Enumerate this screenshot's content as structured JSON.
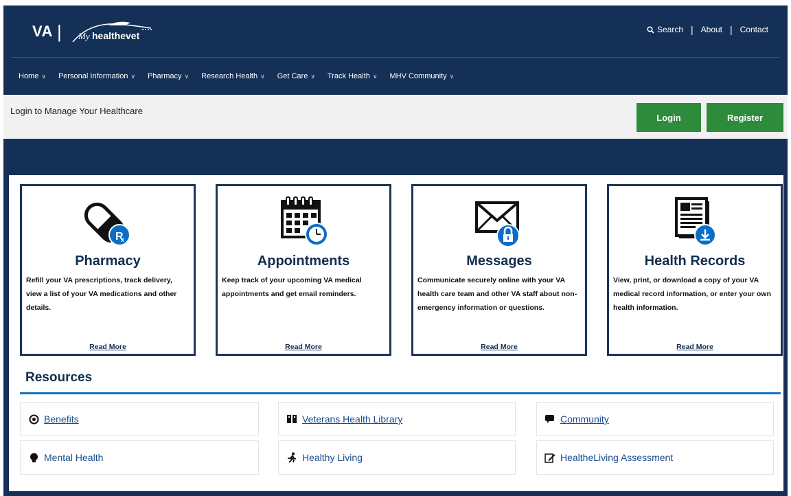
{
  "header": {
    "logo_va": "VA",
    "logo_mhv_script": "My",
    "logo_mhv_text": "healthevet",
    "links": {
      "search": "Search",
      "about": "About",
      "contact": "Contact"
    }
  },
  "nav": {
    "items": [
      {
        "label": "Home"
      },
      {
        "label": "Personal Information"
      },
      {
        "label": "Pharmacy"
      },
      {
        "label": "Research Health"
      },
      {
        "label": "Get Care"
      },
      {
        "label": "Track Health"
      },
      {
        "label": "MHV Community"
      }
    ]
  },
  "login_bar": {
    "text": "Login to Manage Your Healthcare",
    "login_label": "Login",
    "register_label": "Register"
  },
  "cards": [
    {
      "title": "Pharmacy",
      "icon": "pharmacy-rx-icon",
      "desc": "Refill your VA prescriptions, track delivery, view a list of your VA medications and other details.",
      "more": "Read More"
    },
    {
      "title": "Appointments",
      "icon": "calendar-clock-icon",
      "desc": "Keep track of your upcoming VA medical appointments and get email reminders.",
      "more": "Read More"
    },
    {
      "title": "Messages",
      "icon": "envelope-lock-icon",
      "desc": "Communicate securely online with your VA health care team and other VA staff about non-emergency information or questions.",
      "more": "Read More"
    },
    {
      "title": "Health Records",
      "icon": "health-record-download-icon",
      "desc": "View, print, or download a copy of your VA medical record information, or enter your own health information.",
      "more": "Read More"
    }
  ],
  "resources": {
    "title": "Resources",
    "items": [
      {
        "label": "Benefits",
        "icon": "benefits-seal-icon"
      },
      {
        "label": "Veterans Health Library",
        "icon": "library-book-icon"
      },
      {
        "label": "Community",
        "icon": "community-chat-icon"
      },
      {
        "label": "Mental Health",
        "icon": "mental-health-icon"
      },
      {
        "label": "Healthy Living",
        "icon": "running-person-icon"
      },
      {
        "label": "HealtheLiving Assessment",
        "icon": "assessment-edit-icon"
      }
    ]
  },
  "colors": {
    "navy": "#143057",
    "green": "#2e8b3c",
    "blue_accent": "#0d72c0",
    "icon_blue": "#0b6ec6"
  }
}
